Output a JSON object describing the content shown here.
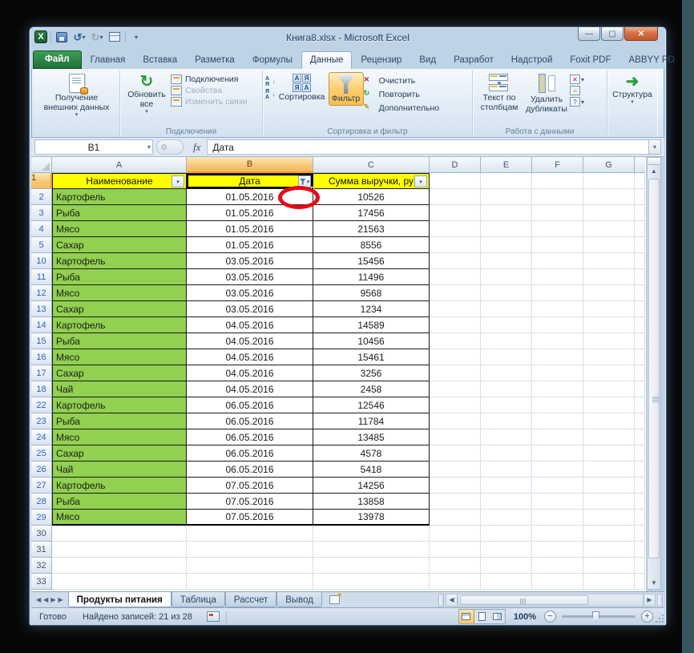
{
  "window": {
    "title": "Книга8.xlsx  -  Microsoft Excel"
  },
  "icons": {
    "undo": "↺",
    "redo": "↻",
    "dropdown": "▾",
    "caret_up": "▴",
    "help": "?",
    "minimize": "—",
    "maximize": "▢",
    "close": "✕",
    "up": "▲",
    "down": "▼",
    "left": "◀",
    "right": "▶",
    "nav_first": "◀",
    "nav_prev": "◀",
    "nav_next": "▶",
    "nav_last": "▶",
    "fx": "fx",
    "sort_a": "А",
    "sort_z": "Я",
    "sort_arrow": "↓",
    "clear_x": "✕",
    "repeat_r": "↻",
    "advanced_p": "✎",
    "minus": "−",
    "plus": "+",
    "outline_arrow": "➜"
  },
  "ribbon": {
    "tabs": [
      {
        "label": "Файл",
        "cls": "file-tab"
      },
      {
        "label": "Главная"
      },
      {
        "label": "Вставка"
      },
      {
        "label": "Разметка"
      },
      {
        "label": "Формулы"
      },
      {
        "label": "Данные",
        "cls": "active"
      },
      {
        "label": "Рецензир"
      },
      {
        "label": "Вид"
      },
      {
        "label": "Разработ"
      },
      {
        "label": "Надстрой"
      },
      {
        "label": "Foxit PDF"
      },
      {
        "label": "ABBYY PD"
      }
    ],
    "groups": {
      "get_external": {
        "label": "Получение внешних данных"
      },
      "connections": {
        "refresh_all": "Обновить все",
        "label": "Подключения",
        "items": [
          {
            "label": "Подключения"
          },
          {
            "label": "Свойства",
            "cls": "disabled"
          },
          {
            "label": "Изменить связи",
            "cls": "disabled"
          }
        ]
      },
      "sort_filter": {
        "sort": "Сортировка",
        "filter": "Фильтр",
        "label": "Сортировка и фильтр",
        "items": [
          {
            "label": "Очистить"
          },
          {
            "label": "Повторить"
          },
          {
            "label": "Дополнительно"
          }
        ]
      },
      "data_tools": {
        "text_to_columns": "Текст по столбцам",
        "remove_duplicates": "Удалить дубликаты",
        "label": "Работа с данными"
      },
      "outline": {
        "label": "Структура"
      }
    }
  },
  "formula_bar": {
    "name_box": "B1",
    "value": "Дата"
  },
  "grid": {
    "columns": [
      {
        "label": "A"
      },
      {
        "label": "B",
        "cls": "sel"
      },
      {
        "label": "C"
      },
      {
        "label": "D"
      },
      {
        "label": "E"
      },
      {
        "label": "F"
      },
      {
        "label": "G"
      }
    ],
    "header_row": {
      "n": "1",
      "a": "Наименование",
      "b": "Дата",
      "c": "Сумма выручки, ру"
    },
    "rows": [
      {
        "n": "2",
        "name": "Картофель",
        "date": "01.05.2016",
        "value": "10526"
      },
      {
        "n": "3",
        "name": "Рыба",
        "date": "01.05.2016",
        "value": "17456"
      },
      {
        "n": "4",
        "name": "Мясо",
        "date": "01.05.2016",
        "value": "21563"
      },
      {
        "n": "5",
        "name": "Сахар",
        "date": "01.05.2016",
        "value": "8556"
      },
      {
        "n": "10",
        "name": "Картофель",
        "date": "03.05.2016",
        "value": "15456"
      },
      {
        "n": "11",
        "name": "Рыба",
        "date": "03.05.2016",
        "value": "11496"
      },
      {
        "n": "12",
        "name": "Мясо",
        "date": "03.05.2016",
        "value": "9568"
      },
      {
        "n": "13",
        "name": "Сахар",
        "date": "03.05.2016",
        "value": "1234"
      },
      {
        "n": "14",
        "name": "Картофель",
        "date": "04.05.2016",
        "value": "14589"
      },
      {
        "n": "15",
        "name": "Рыба",
        "date": "04.05.2016",
        "value": "10456"
      },
      {
        "n": "16",
        "name": "Мясо",
        "date": "04.05.2016",
        "value": "15461"
      },
      {
        "n": "17",
        "name": "Сахар",
        "date": "04.05.2016",
        "value": "3256"
      },
      {
        "n": "18",
        "name": "Чай",
        "date": "04.05.2016",
        "value": "2458"
      },
      {
        "n": "22",
        "name": "Картофель",
        "date": "06.05.2016",
        "value": "12546"
      },
      {
        "n": "23",
        "name": "Рыба",
        "date": "06.05.2016",
        "value": "11784"
      },
      {
        "n": "24",
        "name": "Мясо",
        "date": "06.05.2016",
        "value": "13485"
      },
      {
        "n": "25",
        "name": "Сахар",
        "date": "06.05.2016",
        "value": "4578"
      },
      {
        "n": "26",
        "name": "Чай",
        "date": "06.05.2016",
        "value": "5418"
      },
      {
        "n": "27",
        "name": "Картофель",
        "date": "07.05.2016",
        "value": "14256"
      },
      {
        "n": "28",
        "name": "Рыба",
        "date": "07.05.2016",
        "value": "13858"
      },
      {
        "n": "29",
        "name": "Мясо",
        "date": "07.05.2016",
        "value": "13978",
        "cls": "last-data"
      },
      {
        "n": "30",
        "name": "",
        "date": "",
        "value": "",
        "cls": "empty-row"
      },
      {
        "n": "31",
        "name": "",
        "date": "",
        "value": "",
        "cls": "empty-row"
      },
      {
        "n": "32",
        "name": "",
        "date": "",
        "value": "",
        "cls": "empty-row"
      },
      {
        "n": "33",
        "name": "",
        "date": "",
        "value": "",
        "cls": "empty-row"
      }
    ]
  },
  "sheet_tabs": {
    "tabs": [
      {
        "label": "Продукты питания",
        "cls": "active"
      },
      {
        "label": "Таблица"
      },
      {
        "label": "Рассчет"
      },
      {
        "label": "Вывод"
      }
    ]
  },
  "status_bar": {
    "mode": "Готово",
    "records": "Найдено записей: 21 из 28",
    "zoom": "100%"
  }
}
